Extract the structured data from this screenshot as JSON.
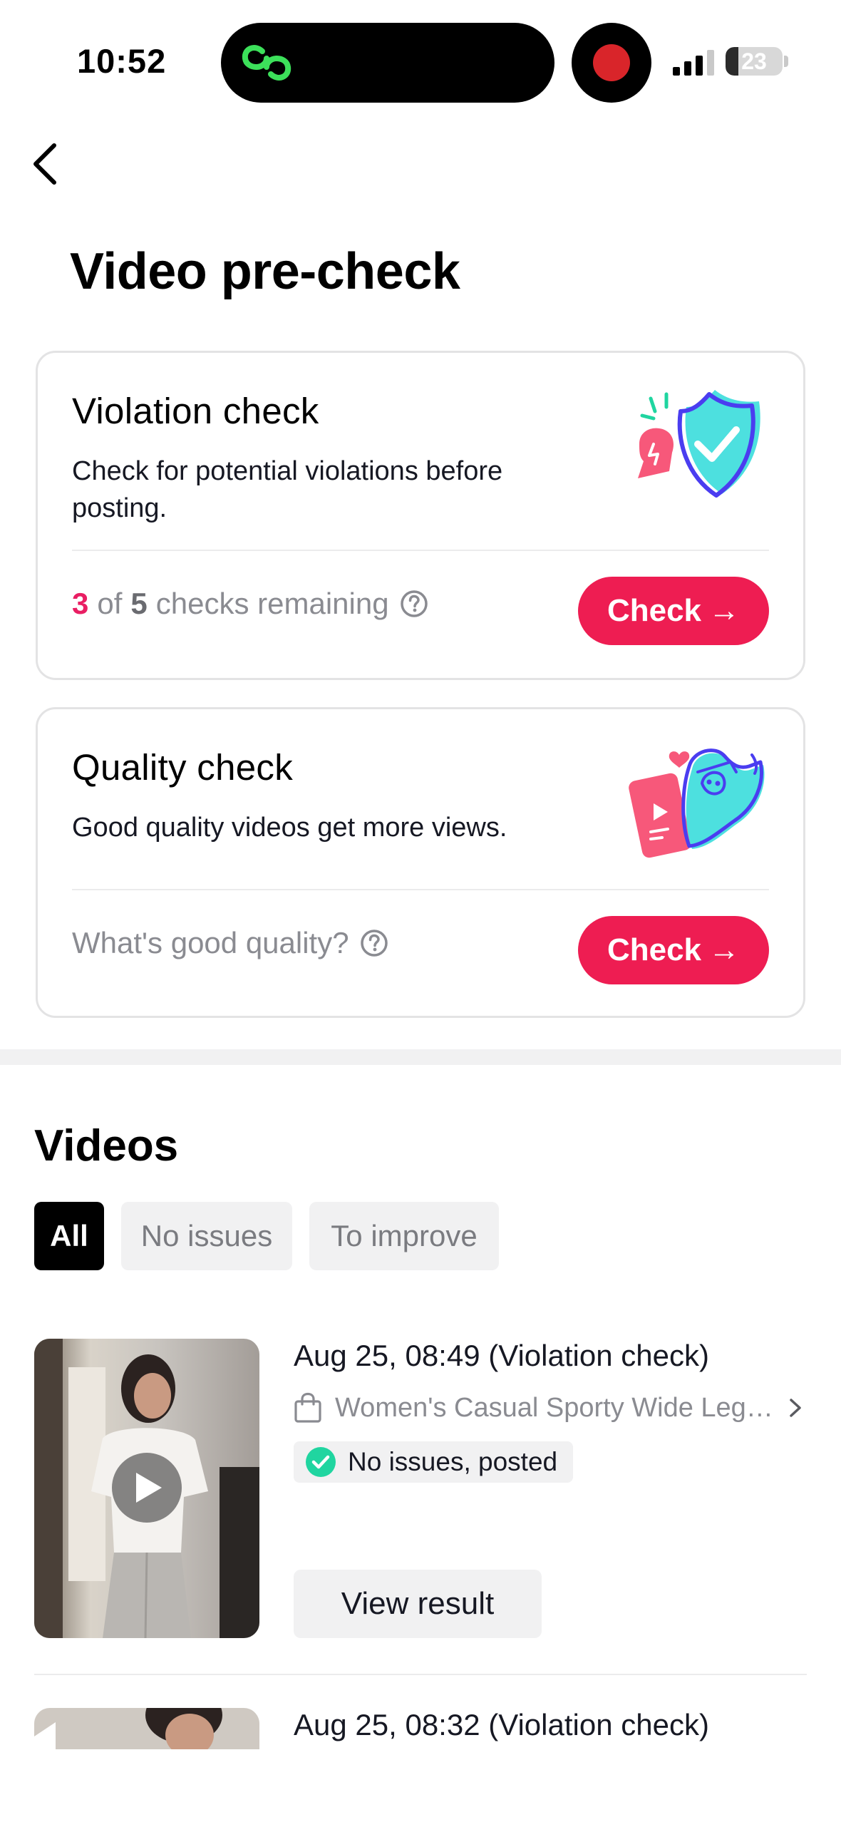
{
  "status_bar": {
    "time": "10:52",
    "battery": "23",
    "battery_level": 0.23
  },
  "header": {
    "back_icon": "chevron-left-icon",
    "title": "Video pre-check"
  },
  "violation_card": {
    "title": "Violation check",
    "description": "Check for potential violations before posting.",
    "remaining_used": "3",
    "remaining_of": "of",
    "remaining_total": "5",
    "remaining_suffix": "checks remaining",
    "help_icon": "question-circle-icon",
    "button_label": "Check",
    "button_arrow": "→",
    "illustration": "shield-check-illustration"
  },
  "quality_card": {
    "title": "Quality check",
    "description": "Good quality videos get more views.",
    "footer_link": "What's good quality?",
    "help_icon": "question-circle-icon",
    "button_label": "Check",
    "button_arrow": "→",
    "illustration": "video-quality-illustration"
  },
  "videos": {
    "title": "Videos",
    "filters": [
      {
        "label": "All",
        "active": true
      },
      {
        "label": "No issues",
        "active": false
      },
      {
        "label": "To improve",
        "active": false
      }
    ],
    "items": [
      {
        "date": "Aug 25, 08:49 (Violation check)",
        "product": "Women's Casual Sporty Wide Leg S...",
        "status": "No issues, posted",
        "action": "View result"
      },
      {
        "date": "Aug 25, 08:32 (Violation check)"
      }
    ]
  },
  "colors": {
    "accent": "#ee1d52",
    "highlight_number": "#e91e63",
    "success": "#20d5a0",
    "chip_active": "#000000",
    "chip_inactive": "#f1f1f2"
  }
}
